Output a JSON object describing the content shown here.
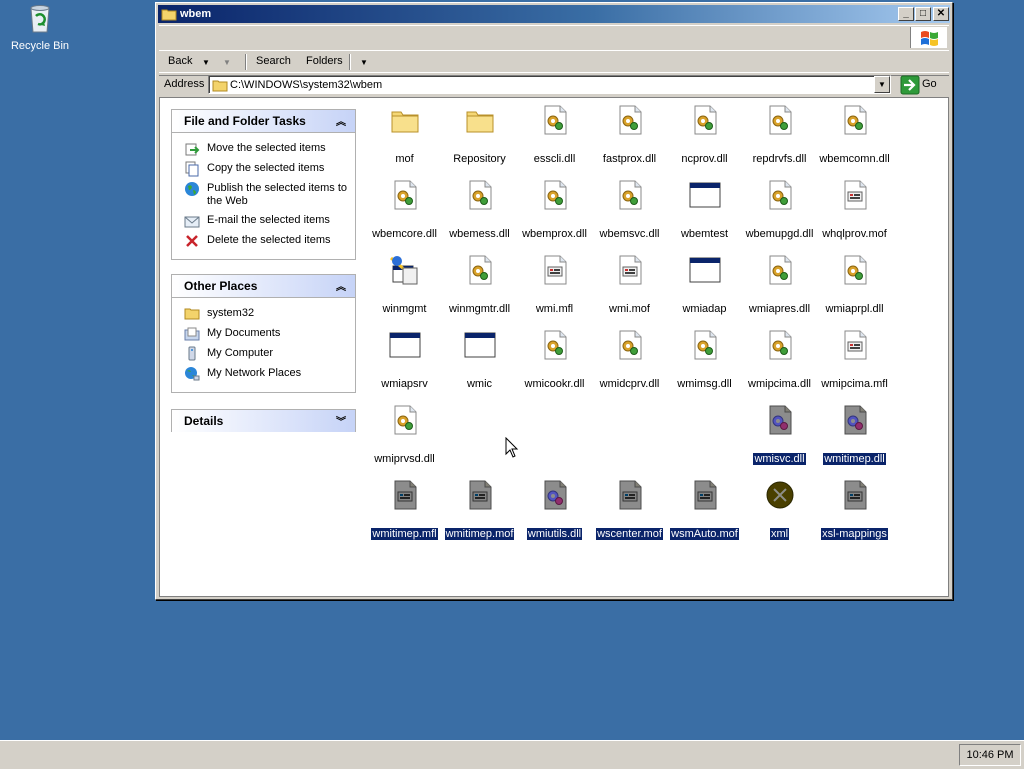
{
  "desktop": {
    "recycle_bin_label": "Recycle Bin"
  },
  "window": {
    "title": "wbem"
  },
  "toolbar": {
    "back_label": "Back",
    "search_label": "Search",
    "folders_label": "Folders"
  },
  "address": {
    "label": "Address",
    "path": "C:\\WINDOWS\\system32\\wbem",
    "go_label": "Go"
  },
  "panels": {
    "tasks": {
      "title": "File and Folder Tasks",
      "items": [
        {
          "label": "Move the selected items",
          "icon": "move-icon"
        },
        {
          "label": "Copy the selected items",
          "icon": "copy-icon"
        },
        {
          "label": "Publish the selected items to the Web",
          "icon": "globe-icon"
        },
        {
          "label": "E-mail the selected items",
          "icon": "email-icon"
        },
        {
          "label": "Delete the selected items",
          "icon": "delete-icon"
        }
      ]
    },
    "places": {
      "title": "Other Places",
      "items": [
        {
          "label": "system32",
          "icon": "folder-icon"
        },
        {
          "label": "My Documents",
          "icon": "documents-icon"
        },
        {
          "label": "My Computer",
          "icon": "computer-icon"
        },
        {
          "label": "My Network Places",
          "icon": "network-icon"
        }
      ]
    },
    "details": {
      "title": "Details"
    }
  },
  "files": [
    {
      "name": "mof",
      "type": "folder",
      "selected": false
    },
    {
      "name": "Repository",
      "type": "folder",
      "selected": false
    },
    {
      "name": "esscli.dll",
      "type": "dll",
      "selected": false
    },
    {
      "name": "fastprox.dll",
      "type": "dll",
      "selected": false
    },
    {
      "name": "ncprov.dll",
      "type": "dll",
      "selected": false
    },
    {
      "name": "repdrvfs.dll",
      "type": "dll",
      "selected": false
    },
    {
      "name": "wbemcomn.dll",
      "type": "dll",
      "selected": false
    },
    {
      "name": "wbemcore.dll",
      "type": "dll",
      "selected": false
    },
    {
      "name": "wbemess.dll",
      "type": "dll",
      "selected": false
    },
    {
      "name": "wbemprox.dll",
      "type": "dll",
      "selected": false
    },
    {
      "name": "wbemsvc.dll",
      "type": "dll",
      "selected": false
    },
    {
      "name": "wbemtest",
      "type": "exe",
      "selected": false
    },
    {
      "name": "wbemupgd.dll",
      "type": "dll",
      "selected": false
    },
    {
      "name": "whqlprov.mof",
      "type": "doc",
      "selected": false
    },
    {
      "name": "winmgmt",
      "type": "winmgmt",
      "selected": false
    },
    {
      "name": "winmgmtr.dll",
      "type": "dll",
      "selected": false
    },
    {
      "name": "wmi.mfl",
      "type": "doc",
      "selected": false
    },
    {
      "name": "wmi.mof",
      "type": "doc",
      "selected": false
    },
    {
      "name": "wmiadap",
      "type": "exe",
      "selected": false
    },
    {
      "name": "wmiapres.dll",
      "type": "dll",
      "selected": false
    },
    {
      "name": "wmiaprpl.dll",
      "type": "dll",
      "selected": false
    },
    {
      "name": "wmiapsrv",
      "type": "exe",
      "selected": false
    },
    {
      "name": "wmic",
      "type": "exe",
      "selected": false
    },
    {
      "name": "wmicookr.dll",
      "type": "dll",
      "selected": false
    },
    {
      "name": "wmidcprv.dll",
      "type": "dll",
      "selected": false
    },
    {
      "name": "wmimsg.dll",
      "type": "dll",
      "selected": false
    },
    {
      "name": "wmipcima.dll",
      "type": "dll",
      "selected": false
    },
    {
      "name": "wmipcima.mfl",
      "type": "doc",
      "selected": false
    },
    {
      "name": "wmiprvsd.dll",
      "type": "dll",
      "selected": false
    },
    {
      "name": "wmisvc.dll",
      "type": "dll",
      "selected": true
    },
    {
      "name": "wmitimep.dll",
      "type": "dll",
      "selected": true
    },
    {
      "name": "wmitimep.mfl",
      "type": "doc",
      "selected": true
    },
    {
      "name": "wmitimep.mof",
      "type": "doc",
      "selected": true
    },
    {
      "name": "wmiutils.dll",
      "type": "dll",
      "selected": true
    },
    {
      "name": "wscenter.mof",
      "type": "doc",
      "selected": true
    },
    {
      "name": "wsmAuto.mof",
      "type": "doc",
      "selected": true
    },
    {
      "name": "xml",
      "type": "xml",
      "selected": true
    },
    {
      "name": "xsl-mappings",
      "type": "doc",
      "selected": true
    }
  ],
  "taskbar": {
    "clock": "10:46 PM"
  },
  "colors": {
    "desktop": "#3a6ea5",
    "selection": "#0a246a",
    "title_start": "#0a246a"
  }
}
